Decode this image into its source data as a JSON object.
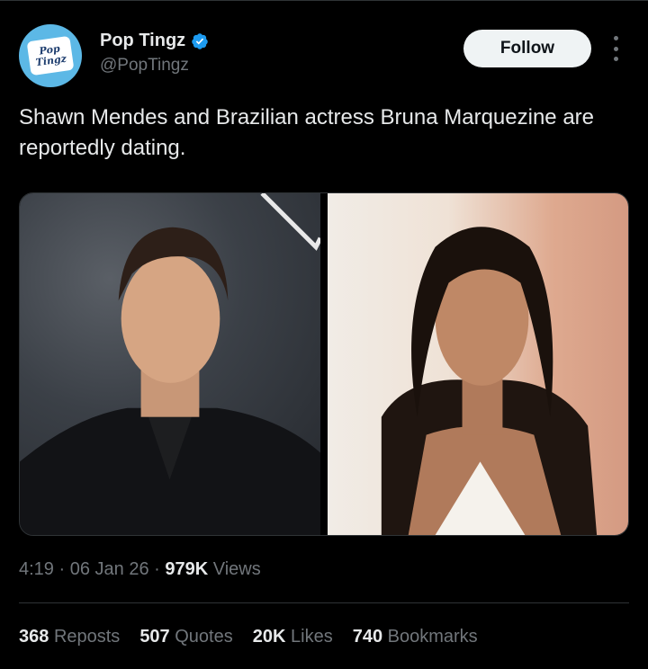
{
  "author": {
    "display_name": "Pop Tingz",
    "handle": "@PopTingz",
    "avatar_line1": "Pop",
    "avatar_line2": "Tingz"
  },
  "follow_label": "Follow",
  "tweet_text": "Shawn Mendes and Brazilian actress Bruna Marquezine are reportedly dating.",
  "meta": {
    "time": "4:19",
    "date": "06 Jan 26",
    "views_count": "979K",
    "views_label": "Views"
  },
  "stats": {
    "reposts_count": "368",
    "reposts_label": "Reposts",
    "quotes_count": "507",
    "quotes_label": "Quotes",
    "likes_count": "20K",
    "likes_label": "Likes",
    "bookmarks_count": "740",
    "bookmarks_label": "Bookmarks"
  },
  "colors": {
    "background": "#000000",
    "verified_blue": "#1d9bf0",
    "secondary_text": "#71767b"
  }
}
